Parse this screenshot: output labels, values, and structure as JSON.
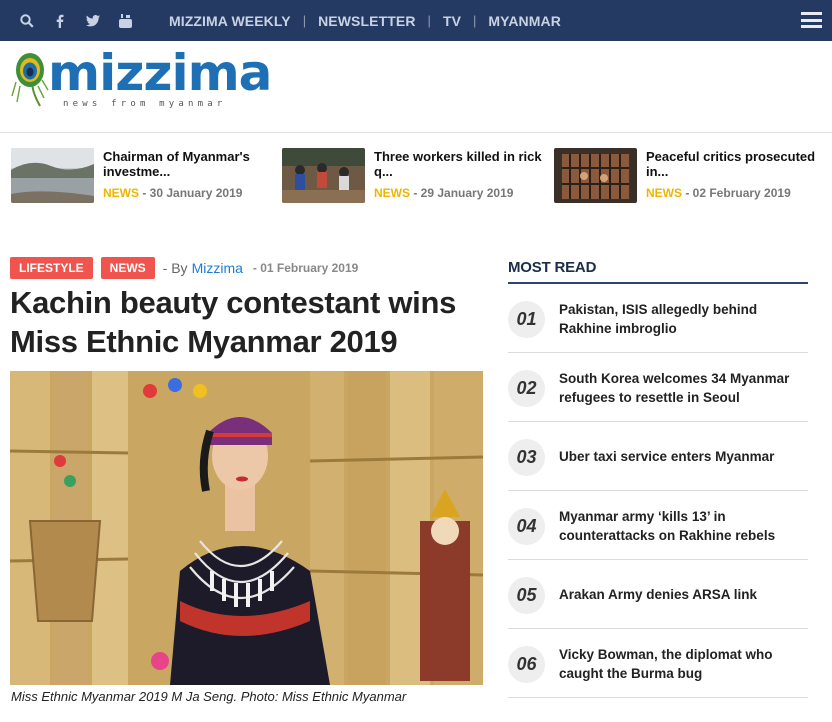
{
  "topbar": {
    "icons": [
      "search-icon",
      "facebook-icon",
      "twitter-icon",
      "youtube-icon"
    ],
    "nav": [
      "MIZZIMA WEEKLY",
      "NEWSLETTER",
      "TV",
      "MYANMAR"
    ],
    "background": "#243a63"
  },
  "logo": {
    "word": "mizzima",
    "tagline": "news from myanmar"
  },
  "ticker": [
    {
      "title": "Chairman of Myanmar's investme...",
      "category": "NEWS",
      "date": "- 30 January 2019"
    },
    {
      "title": "Three workers killed in rick q...",
      "category": "NEWS",
      "date": "- 29 January 2019"
    },
    {
      "title": "Peaceful critics prosecuted in...",
      "category": "NEWS",
      "date": "- 02 February 2019"
    }
  ],
  "article": {
    "tags": [
      "LIFESTYLE",
      "NEWS"
    ],
    "by": "- By",
    "author": "Mizzima",
    "date": "- 01 February 2019",
    "headline": "Kachin beauty contestant wins Miss Ethnic Myanmar 2019",
    "caption": "Miss Ethnic Myanmar 2019 M Ja Seng. Photo: Miss Ethnic Myanmar"
  },
  "most_read": {
    "title": "MOST READ",
    "items": [
      {
        "num": "01",
        "text": "Pakistan, ISIS allegedly behind Rakhine imbroglio"
      },
      {
        "num": "02",
        "text": "South Korea welcomes 34 Myanmar refugees to resettle in Seoul"
      },
      {
        "num": "03",
        "text": "Uber taxi service enters Myanmar"
      },
      {
        "num": "04",
        "text": "Myanmar army ‘kills 13’ in counterattacks on Rakhine rebels"
      },
      {
        "num": "05",
        "text": "Arakan Army denies ARSA link"
      },
      {
        "num": "06",
        "text": "Vicky Bowman, the diplomat who caught the Burma bug"
      }
    ]
  },
  "colors": {
    "accent": "#1f6fb5",
    "badge": "#f0544f",
    "news_category": "#f0b400"
  }
}
